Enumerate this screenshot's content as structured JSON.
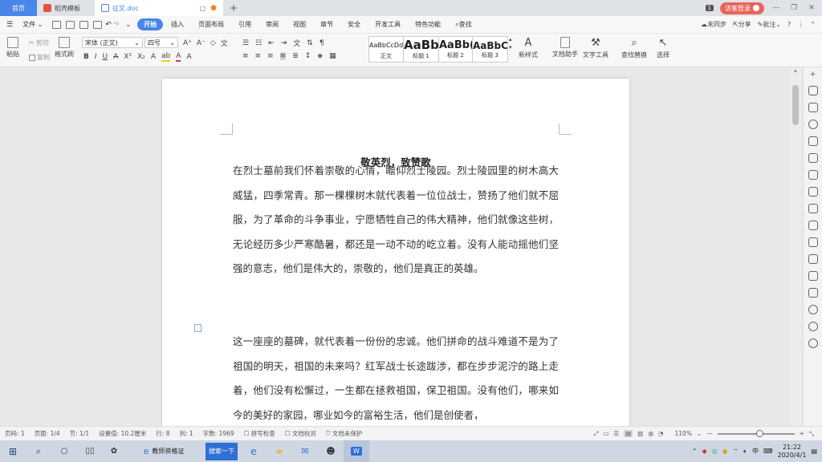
{
  "tabs": {
    "home": "首页",
    "template": "稻壳模板",
    "document": "征文.doc",
    "badge": "1",
    "login": "访客登录"
  },
  "menu": {
    "file": "文件",
    "items": [
      "开始",
      "插入",
      "页面布局",
      "引用",
      "审阅",
      "视图",
      "章节",
      "安全",
      "开发工具",
      "特色功能"
    ],
    "search": "查找",
    "unsynced": "未同步",
    "share": "分享",
    "annotate": "批注"
  },
  "toolbar": {
    "paste": "粘贴",
    "cut": "剪切",
    "copy": "复制",
    "format_painter": "格式刷",
    "font_name": "宋体 (正文)",
    "font_size": "四号",
    "styles": [
      {
        "sample": "AaBbCcDd",
        "name": "正文"
      },
      {
        "sample": "AaBb",
        "name": "标题 1"
      },
      {
        "sample": "AaBb(",
        "name": "标题 2"
      },
      {
        "sample": "AaBbC",
        "name": "标题 3"
      }
    ],
    "new_style": "新样式",
    "doc_assistant": "文档助手",
    "text_tools": "文字工具",
    "find_replace": "查找替换",
    "select": "选择"
  },
  "document": {
    "title": "敬英烈，致赞歌",
    "paragraphs": [
      "在烈士墓前我们怀着崇敬的心情，瞻仰烈士陵园。烈士陵园里的树木高大威猛，四季常青。那一棵棵树木就代表着一位位战士，赞扬了他们就不屈服，为了革命的斗争事业，宁愿牺牲自己的伟大精神，他们就像这些树，无论经历多少严寒酷暑，都还是一动不动的屹立着。没有人能动摇他们坚强的意志，他们是伟大的，崇敬的，他们是真正的英雄。",
      "这一座座的墓碑，就代表着一份份的忠诚。他们拼命的战斗难道不是为了祖国的明天，祖国的未来吗？红军战士长途跋涉，都在步步泥泞的路上走着，他们没有松懈过，一生都在拯救祖国，保卫祖国。没有他们，哪来如今的美好的家园，哪业如今的富裕生活，他们是创使者，"
    ]
  },
  "status": {
    "page_num": "页码: 1",
    "pages": "页面: 1/4",
    "section": "节: 1/1",
    "setting": "设置值: 10.2厘米",
    "row": "行: 8",
    "col": "列: 1",
    "word_count": "字数: 1969",
    "spell_check": "拼写检查",
    "doc_proof": "文档校对",
    "doc_protect": "文档未保护",
    "zoom": "110%",
    "zoom_fraction": 0.5
  },
  "taskbar": {
    "app1": "教师资格证",
    "search": "搜索一下",
    "ime": "中",
    "time": "21:22",
    "date": "2020/4/1"
  }
}
